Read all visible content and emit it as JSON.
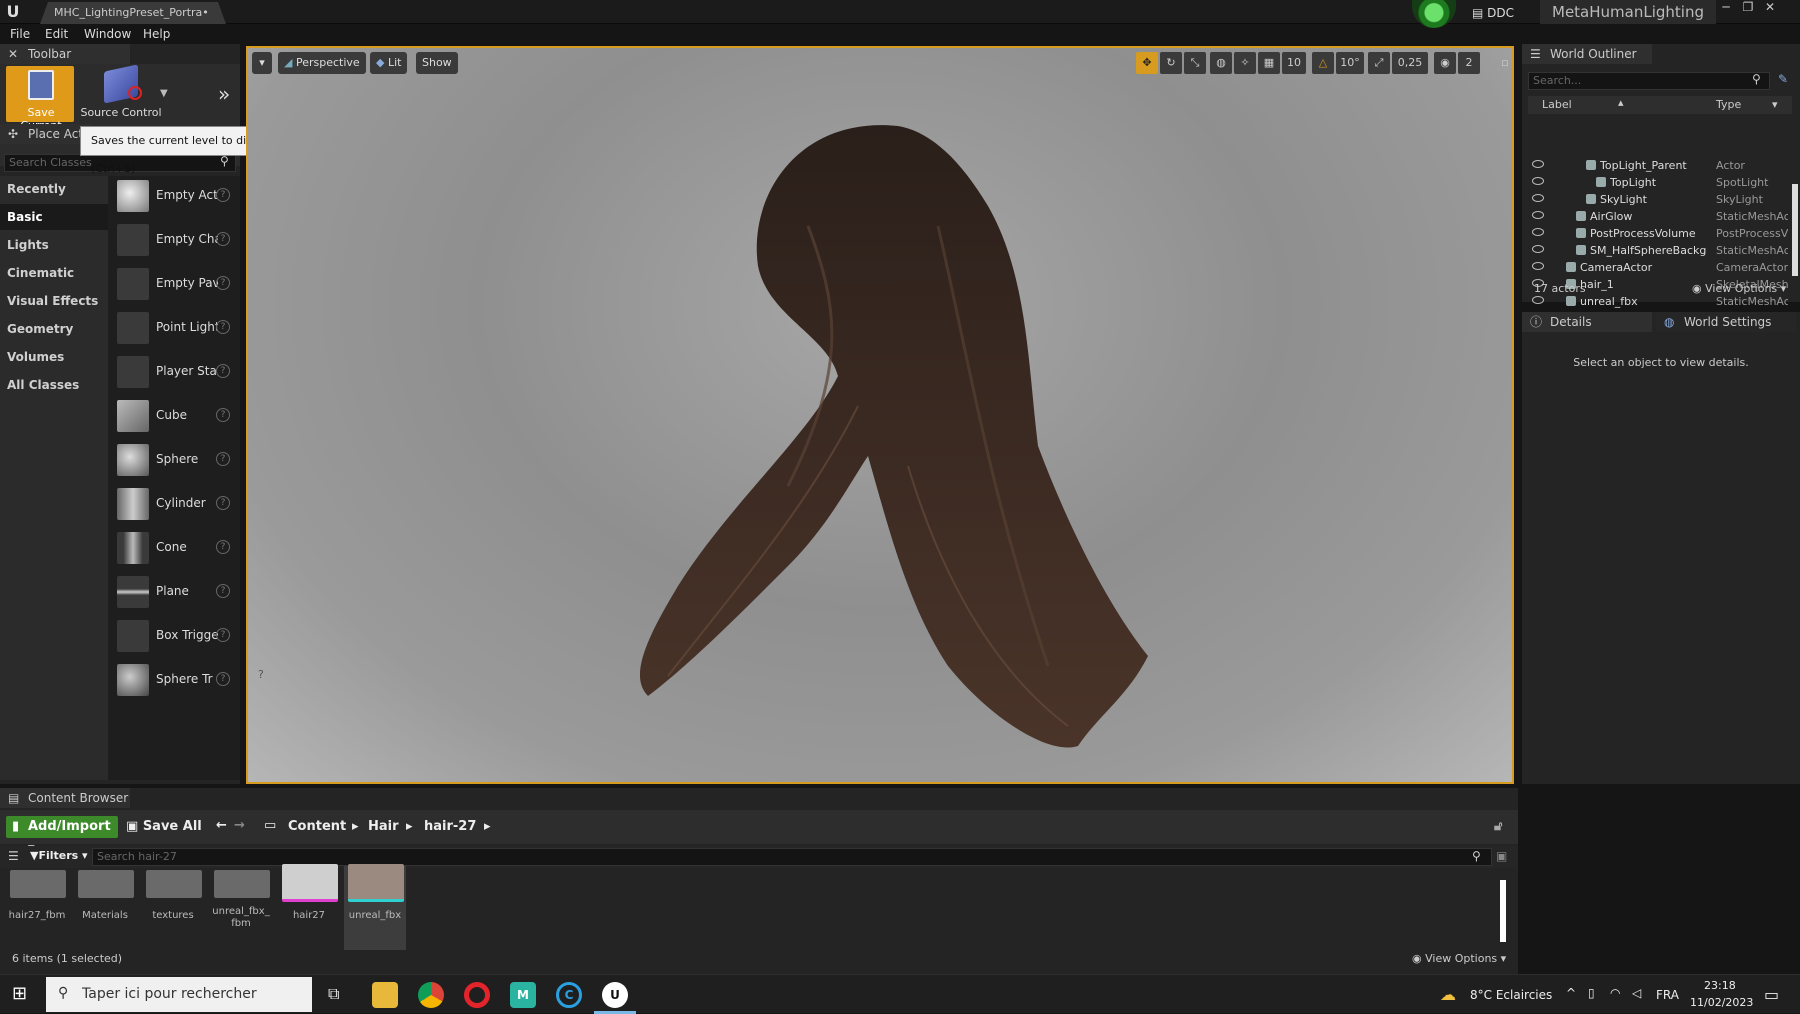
{
  "window": {
    "doc_tab": "MHC_LightingPreset_Portra•",
    "ddc_label": "DDC",
    "project_name": "MetaHumanLighting",
    "min": "─",
    "restore": "❐",
    "close": "✕"
  },
  "menu": [
    "File",
    "Edit",
    "Window",
    "Help"
  ],
  "toolbar": {
    "tab_label": "Toolbar",
    "save_current": "Save Current",
    "source_control": "Source Control",
    "tooltip": "Saves the current level to disk (Ctrl+S)"
  },
  "place_actors": {
    "tab_label": "Place Acto",
    "search_placeholder": "Search Classes",
    "categories": [
      "Recently Placed",
      "Basic",
      "Lights",
      "Cinematic",
      "Visual Effects",
      "Geometry",
      "Volumes",
      "All Classes"
    ],
    "active_category": "Basic",
    "items": [
      "Empty Act",
      "Empty Cha",
      "Empty Pav",
      "Point Light",
      "Player Sta",
      "Cube",
      "Sphere",
      "Cylinder",
      "Cone",
      "Plane",
      "Box Trigge",
      "Sphere Tr"
    ]
  },
  "viewport": {
    "perspective": "Perspective",
    "lit": "Lit",
    "show": "Show",
    "grid_size": "10",
    "rotation_snap": "10°",
    "scale_snap": "0,25",
    "camera_speed": "2",
    "accent_color": "#d79b1f"
  },
  "outliner": {
    "tab_label": "World Outliner",
    "search_placeholder": "Search...",
    "col_label": "Label",
    "col_type": "Type",
    "rows": [
      {
        "label": "TopLight_Parent",
        "type": "Actor",
        "indent": 3
      },
      {
        "label": "TopLight",
        "type": "SpotLight",
        "indent": 4
      },
      {
        "label": "SkyLight",
        "type": "SkyLight",
        "indent": 3
      },
      {
        "label": "AirGlow",
        "type": "StaticMeshAc",
        "indent": 2
      },
      {
        "label": "PostProcessVolume",
        "type": "PostProcessV",
        "indent": 2
      },
      {
        "label": "SM_HalfSphereBackg",
        "type": "StaticMeshAc",
        "indent": 2
      },
      {
        "label": "CameraActor",
        "type": "CameraActor",
        "indent": 1
      },
      {
        "label": "hair_1",
        "type": "SkeletalMesh",
        "indent": 1
      },
      {
        "label": "unreal_fbx",
        "type": "StaticMeshAc",
        "indent": 1
      }
    ],
    "actors_count": "17 actors",
    "view_options": "View Options"
  },
  "details": {
    "tab_label": "Details",
    "world_settings": "World Settings",
    "empty_msg": "Select an object to view details."
  },
  "content_browser": {
    "tab_label": "Content Browser",
    "add_import": "Add/Import",
    "save_all": "Save All",
    "breadcrumb": [
      "Content",
      "Hair",
      "hair-27"
    ],
    "filters": "Filters",
    "search_placeholder": "Search hair-27",
    "assets": [
      "hair27_fbm",
      "Materials",
      "textures",
      "unreal_fbx_\nfbm",
      "hair27",
      "unreal_fbx"
    ],
    "items_count": "6 items (1 selected)",
    "view_options": "View Options"
  },
  "taskbar": {
    "search_placeholder": "Taper ici pour rechercher",
    "weather": "8°C  Eclaircies",
    "lang": "FRA",
    "time": "23:18",
    "date": "11/02/2023"
  }
}
